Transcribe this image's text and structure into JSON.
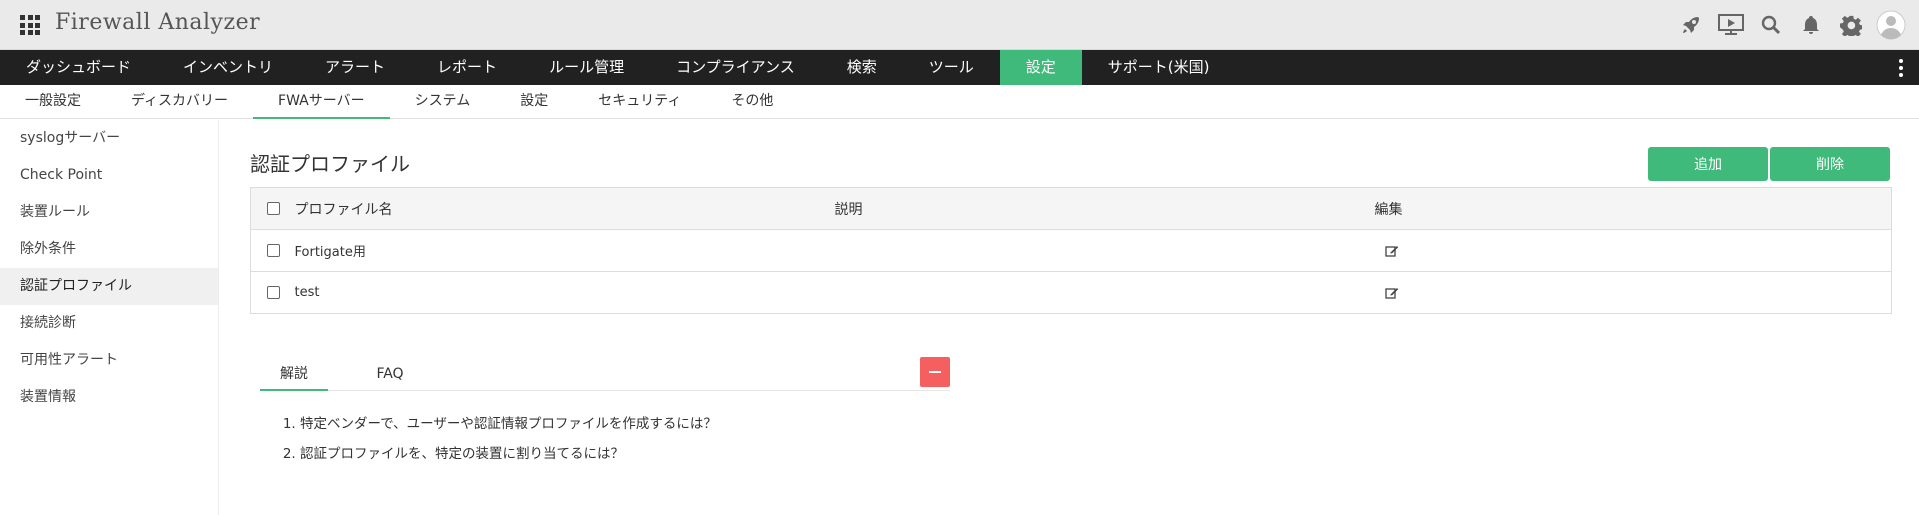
{
  "app": {
    "title": "Firewall Analyzer"
  },
  "main_nav": [
    {
      "label": "ダッシュボード",
      "active": false
    },
    {
      "label": "インベントリ",
      "active": false
    },
    {
      "label": "アラート",
      "active": false
    },
    {
      "label": "レポート",
      "active": false
    },
    {
      "label": "ルール管理",
      "active": false
    },
    {
      "label": "コンプライアンス",
      "active": false
    },
    {
      "label": "検索",
      "active": false
    },
    {
      "label": "ツール",
      "active": false
    },
    {
      "label": "設定",
      "active": true
    },
    {
      "label": "サポート(米国)",
      "active": false
    }
  ],
  "sub_nav": [
    {
      "label": "一般設定"
    },
    {
      "label": "ディスカバリー"
    },
    {
      "label": "FWAサーバー"
    },
    {
      "label": "システム"
    },
    {
      "label": "設定"
    },
    {
      "label": "セキュリティ"
    },
    {
      "label": "その他"
    }
  ],
  "sidebar": [
    {
      "label": "syslogサーバー"
    },
    {
      "label": "Check Point"
    },
    {
      "label": "装置ルール"
    },
    {
      "label": "除外条件"
    },
    {
      "label": "認証プロファイル"
    },
    {
      "label": "接続診断"
    },
    {
      "label": "可用性アラート"
    },
    {
      "label": "装置情報"
    }
  ],
  "page": {
    "title": "認証プロファイル",
    "add_label": "追加",
    "delete_label": "削除"
  },
  "table": {
    "headers": {
      "name": "プロファイル名",
      "description": "説明",
      "edit": "編集"
    },
    "rows": [
      {
        "name": "Fortigate用",
        "description": ""
      },
      {
        "name": "test",
        "description": ""
      }
    ]
  },
  "help": {
    "tabs": [
      "解説",
      "FAQ"
    ],
    "items": [
      "特定ベンダーで、ユーザーや認証情報プロファイルを作成するには？",
      "認証プロファイルを、特定の装置に割り当てるには？"
    ]
  },
  "colors": {
    "accent": "#3fba7a",
    "nav_bg": "#212121",
    "collapse": "#f55f5f"
  }
}
